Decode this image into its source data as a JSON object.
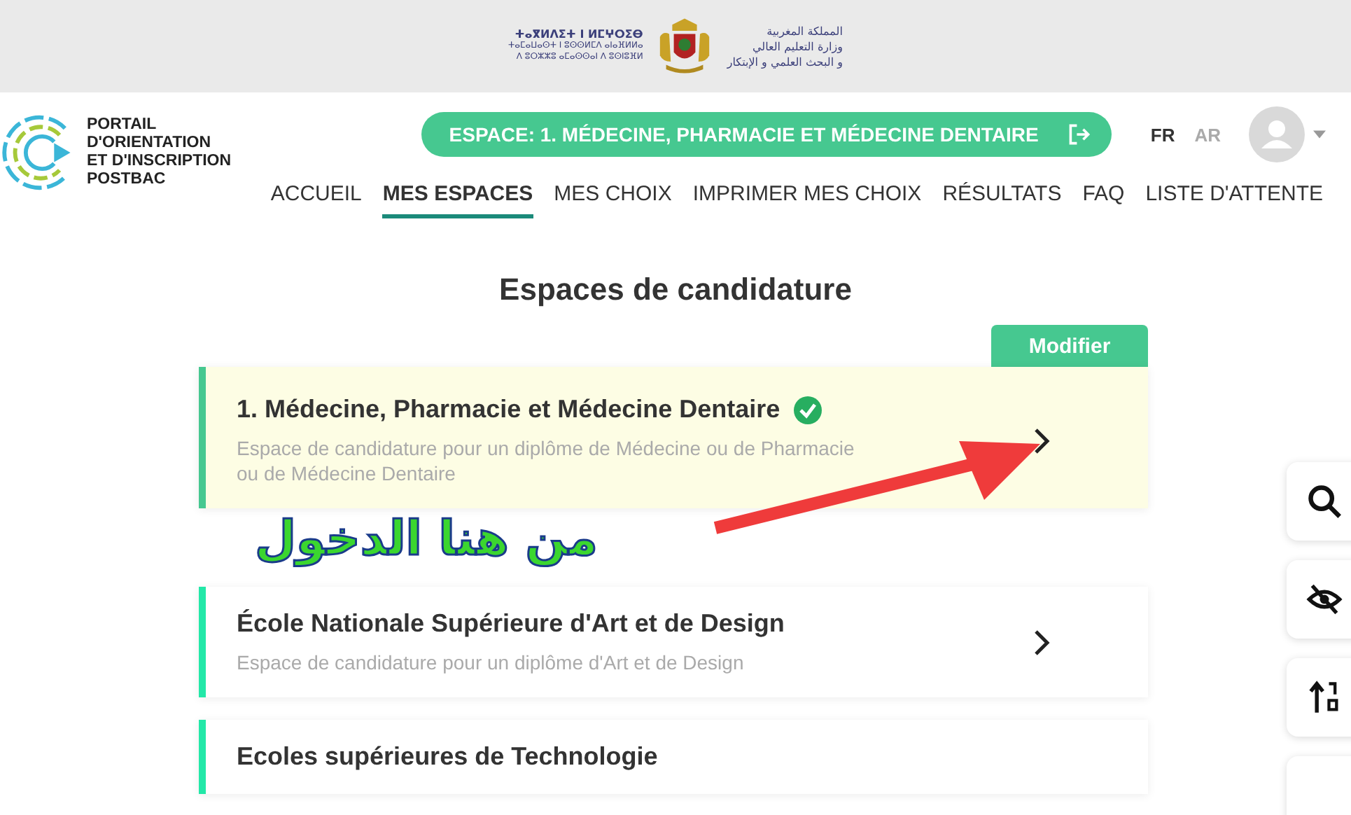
{
  "header": {
    "tifinagh_lines": [
      "ⵜⴰⴳⵍⴷⵉⵜ ⵏ ⵍⵎⵖⵔⵉⴱ",
      "ⵜⴰⵎⴰⵡⴰⵙⵜ ⵏ ⵓⵙⵙⵍⵎⴷ ⴰⵏⴰⴼⵍⵍⴰ",
      "ⴷ ⵓⵔⵣⵣⵓ ⴰⵎⴰⵙⵙⴰⵏ ⴷ ⵓⵙⵏⵓⴼⵍ"
    ],
    "arabic_lines": [
      "المملكة المغربية",
      "وزارة التعليم العالي",
      "و البحث العلمي و الإبتكار"
    ]
  },
  "logo": {
    "lines": [
      "PORTAIL",
      "D'ORIENTATION",
      "ET D'INSCRIPTION",
      "POSTBAC"
    ]
  },
  "space_button": {
    "label": "ESPACE: 1. MÉDECINE, PHARMACIE ET MÉDECINE DENTAIRE"
  },
  "languages": [
    {
      "label": "FR",
      "selected": true
    },
    {
      "label": "AR",
      "selected": false
    }
  ],
  "nav": [
    {
      "label": "ACCUEIL",
      "selected": false
    },
    {
      "label": "MES ESPACES",
      "selected": true
    },
    {
      "label": "MES CHOIX",
      "selected": false
    },
    {
      "label": "IMPRIMER MES CHOIX",
      "selected": false
    },
    {
      "label": "RÉSULTATS",
      "selected": false
    },
    {
      "label": "FAQ",
      "selected": false
    },
    {
      "label": "LISTE D'ATTENTE",
      "selected": false
    }
  ],
  "heading": "Espaces de candidature",
  "modify_button": "Modifier",
  "spaces": [
    {
      "title": "1. Médecine, Pharmacie et Médecine Dentaire",
      "description": "Espace de candidature pour un diplôme de Médecine ou de Pharmacie ou de Médecine Dentaire",
      "selected": true,
      "verified": true
    },
    {
      "title": "École Nationale Supérieure d'Art et de Design",
      "description": "Espace de candidature pour un diplôme d'Art et de Design",
      "selected": false,
      "verified": false
    },
    {
      "title": "Ecoles supérieures de Technologie",
      "selected": false,
      "verified": false
    }
  ],
  "annotation": "من هنا الدخول",
  "side_tools": [
    {
      "kind": "search"
    },
    {
      "kind": "eye-off"
    },
    {
      "kind": "sort"
    },
    {
      "kind": "blank"
    }
  ]
}
